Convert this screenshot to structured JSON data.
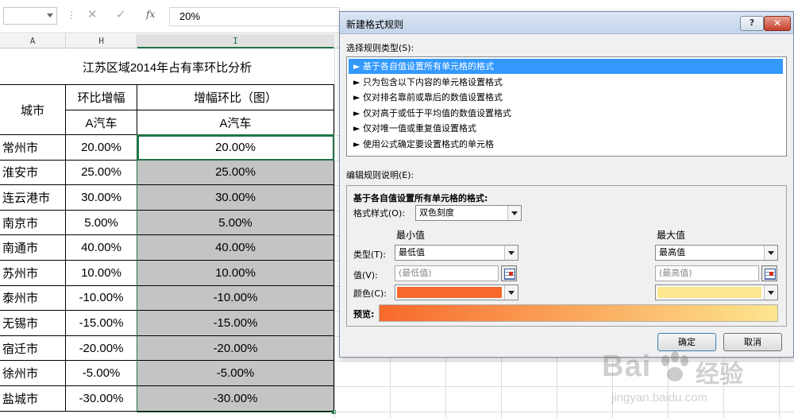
{
  "formula_bar": {
    "name_box": "",
    "separator": "⋮",
    "cancel_icon": "✕",
    "enter_icon": "✓",
    "fx_label": "fx",
    "formula": "20%"
  },
  "columns": [
    "A",
    "H",
    "I"
  ],
  "sheet": {
    "title": "江苏区域2014年占有率环比分析",
    "header_city": "城市",
    "header_growth": "环比增幅",
    "header_chart": "增幅环比（图）",
    "sub_growth": "A汽车",
    "sub_chart": "A汽车",
    "rows": [
      {
        "city": "常州市",
        "growth": "20.00%",
        "chart": "20.00%"
      },
      {
        "city": "淮安市",
        "growth": "25.00%",
        "chart": "25.00%"
      },
      {
        "city": "连云港市",
        "growth": "30.00%",
        "chart": "30.00%"
      },
      {
        "city": "南京市",
        "growth": "5.00%",
        "chart": "5.00%"
      },
      {
        "city": "南通市",
        "growth": "40.00%",
        "chart": "40.00%"
      },
      {
        "city": "苏州市",
        "growth": "10.00%",
        "chart": "10.00%"
      },
      {
        "city": "泰州市",
        "growth": "-10.00%",
        "chart": "-10.00%"
      },
      {
        "city": "无锡市",
        "growth": "-15.00%",
        "chart": "-15.00%"
      },
      {
        "city": "宿迁市",
        "growth": "-20.00%",
        "chart": "-20.00%"
      },
      {
        "city": "徐州市",
        "growth": "-5.00%",
        "chart": "-5.00%"
      },
      {
        "city": "盐城市",
        "growth": "-30.00%",
        "chart": "-30.00%"
      }
    ]
  },
  "dialog": {
    "title": "新建格式规则",
    "help": "?",
    "close": "✕",
    "select_rule_type_label": "选择规则类型(S):",
    "rule_types": [
      "► 基于各自值设置所有单元格的格式",
      "► 只为包含以下内容的单元格设置格式",
      "► 仅对排名靠前或靠后的数值设置格式",
      "► 仅对高于或低于平均值的数值设置格式",
      "► 仅对唯一值或重复值设置格式",
      "► 使用公式确定要设置格式的单元格"
    ],
    "edit_rule_label": "编辑规则说明(E):",
    "edit_heading": "基于各自值设置所有单元格的格式:",
    "format_style_label": "格式样式(O):",
    "format_style_value": "双色刻度",
    "min_label": "最小值",
    "max_label": "最大值",
    "type_label": "类型(T):",
    "value_label": "值(V):",
    "color_label": "颜色(C):",
    "min_type": "最低值",
    "max_type": "最高值",
    "min_value_placeholder": "(最低值)",
    "max_value_placeholder": "(最高值)",
    "min_color": "#f8692b",
    "max_color": "#fde68e",
    "preview_label": "预览:",
    "ok": "确定",
    "cancel": "取消"
  },
  "watermark": {
    "brand": "Bai",
    "brand2": "经验",
    "url": "jingyan.baidu.com"
  }
}
